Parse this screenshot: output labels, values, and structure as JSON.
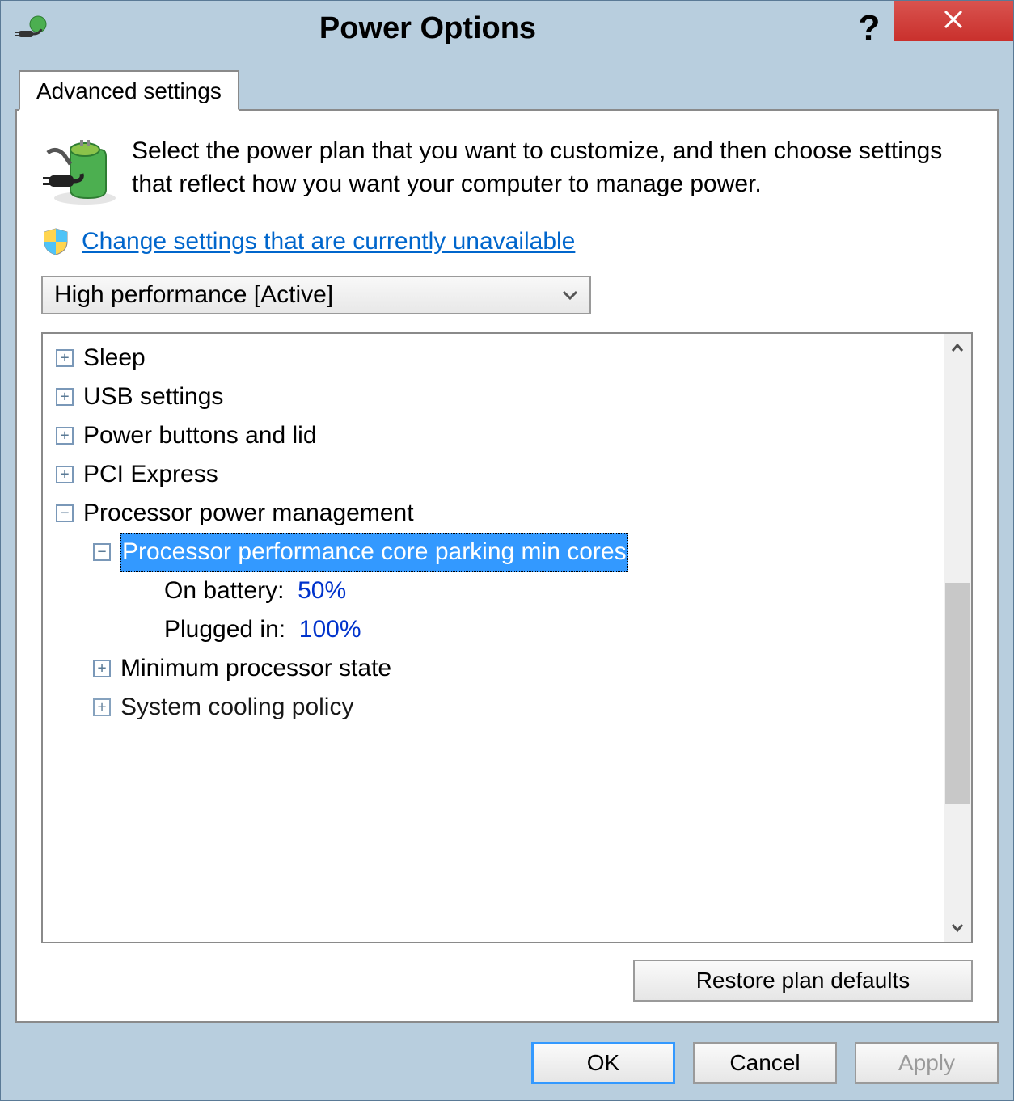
{
  "window": {
    "title": "Power Options"
  },
  "tab": {
    "label": "Advanced settings"
  },
  "intro": "Select the power plan that you want to customize, and then choose settings that reflect how you want your computer to manage power.",
  "changeLink": "Change settings that are currently unavailable",
  "planSelect": {
    "selected": "High performance [Active]"
  },
  "tree": {
    "sleep": "Sleep",
    "usb": "USB settings",
    "powerButtons": "Power buttons and lid",
    "pci": "PCI Express",
    "processor": "Processor power management",
    "coreParking": "Processor performance core parking min cores",
    "onBatteryLabel": "On battery:",
    "onBatteryValue": "50%",
    "pluggedInLabel": "Plugged in:",
    "pluggedInValue": "100%",
    "minProcessor": "Minimum processor state",
    "systemCooling": "System cooling policy"
  },
  "buttons": {
    "restore": "Restore plan defaults",
    "ok": "OK",
    "cancel": "Cancel",
    "apply": "Apply"
  }
}
